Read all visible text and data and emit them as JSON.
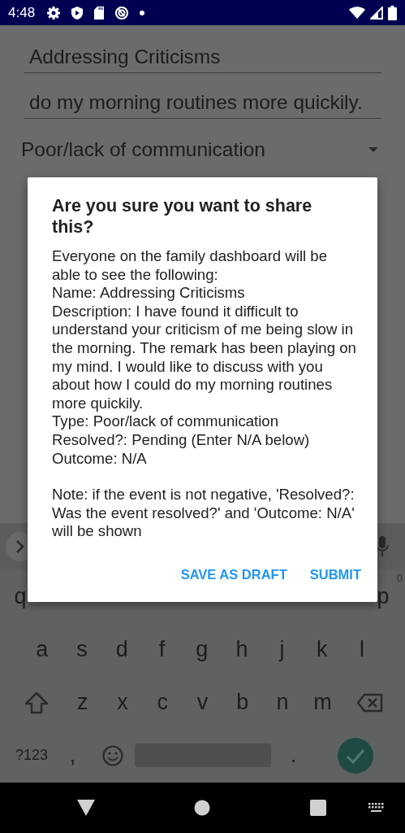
{
  "status_bar": {
    "time": "4:48"
  },
  "form": {
    "name": "Addressing Criticisms",
    "description": "do my morning routines more quickily.",
    "type": "Poor/lack of communication"
  },
  "keyboard": {
    "rows": [
      [
        {
          "kind": "char",
          "label": "q"
        },
        {
          "kind": "char",
          "label": "p",
          "hint": "0"
        }
      ],
      [
        {
          "kind": "char",
          "label": "a"
        },
        {
          "kind": "char",
          "label": "s"
        },
        {
          "kind": "char",
          "label": "d"
        },
        {
          "kind": "char",
          "label": "f"
        },
        {
          "kind": "char",
          "label": "g"
        },
        {
          "kind": "char",
          "label": "h"
        },
        {
          "kind": "char",
          "label": "j"
        },
        {
          "kind": "char",
          "label": "k"
        },
        {
          "kind": "char",
          "label": "l"
        }
      ],
      [
        {
          "kind": "shift"
        },
        {
          "kind": "char",
          "label": "z"
        },
        {
          "kind": "char",
          "label": "x"
        },
        {
          "kind": "char",
          "label": "c"
        },
        {
          "kind": "char",
          "label": "v"
        },
        {
          "kind": "char",
          "label": "b"
        },
        {
          "kind": "char",
          "label": "n"
        },
        {
          "kind": "char",
          "label": "m"
        },
        {
          "kind": "backspace"
        }
      ],
      [
        {
          "kind": "symbols",
          "label": "?123"
        },
        {
          "kind": "char",
          "label": ","
        },
        {
          "kind": "emoji"
        },
        {
          "kind": "space"
        },
        {
          "kind": "char",
          "label": "."
        },
        {
          "kind": "enter"
        }
      ]
    ]
  },
  "dialog": {
    "title": "Are you sure you want to share this?",
    "lines": [
      "Everyone on the family dashboard will be able to see the following:",
      "Name: Addressing Criticisms",
      "Description: I have found it difficult to understand your criticism of me being slow in the morning. The remark has been playing on my mind. I would like to discuss with you about how I could do my morning routines more quickily.",
      "Type: Poor/lack of communication",
      "Resolved?: Pending (Enter N/A below)",
      "Outcome: N/A"
    ],
    "note": "Note: if the event is not negative, 'Resolved?: Was the event resolved?' and 'Outcome: N/A' will be shown",
    "buttons": [
      "SAVE AS DRAFT",
      "SUBMIT"
    ]
  }
}
